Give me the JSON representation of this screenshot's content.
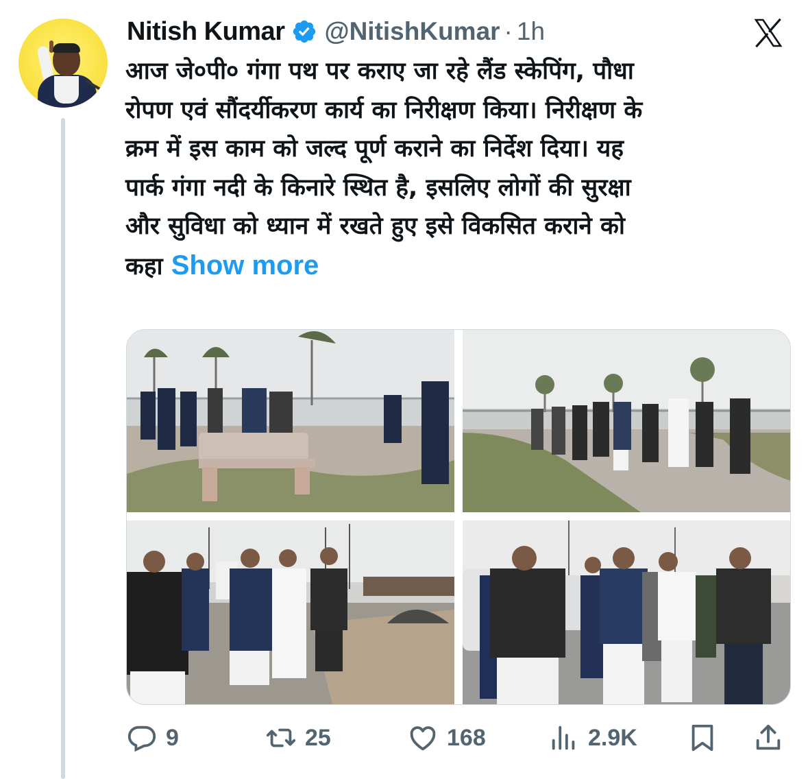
{
  "author": {
    "name": "Nitish Kumar",
    "handle": "@NitishKumar",
    "separator": "·",
    "time": "1h",
    "verified": true,
    "avatar": "profile-photo"
  },
  "platform_logo": "x-logo",
  "tweet": {
    "lines": [
      "आज जे०पी० गंगा पथ पर कराए जा रहे लैंड स्केपिंग, पौधा",
      "रोपण एवं सौंदर्यीकरण कार्य का निरीक्षण किया। निरीक्षण के",
      "क्रम में इस काम को जल्द पूर्ण कराने का निर्देश दिया। यह",
      "पार्क गंगा नदी के किनारे स्थित है, इसलिए लोगों की सुरक्षा",
      "और सुविधा को ध्यान में रखते हुए इसे विकसित कराने को"
    ],
    "last_line": "कहा",
    "show_more": "Show more"
  },
  "media": [
    {
      "scene": "officials walking past a stone bench on a landscaped promenade"
    },
    {
      "scene": "group of officials inspecting plantation along the riverside path"
    },
    {
      "scene": "officials walking on a road near construction material"
    },
    {
      "scene": "officials standing and talking near parked cars"
    }
  ],
  "actions": {
    "replies": "9",
    "reposts": "25",
    "likes": "168",
    "views": "2.9K"
  },
  "colors": {
    "text": "#0f1419",
    "secondary": "#536471",
    "link": "#1d9bf0",
    "verified": "#1d9bf0",
    "thread_line": "#cfd9de"
  },
  "icons": [
    "reply-icon",
    "repost-icon",
    "like-icon",
    "views-icon",
    "bookmark-icon",
    "share-icon",
    "verified-badge-icon"
  ]
}
